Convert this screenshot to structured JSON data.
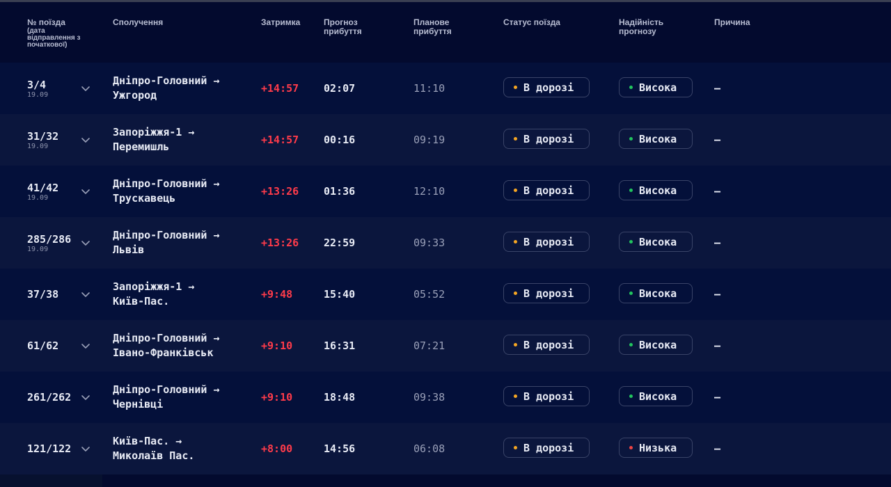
{
  "header": {
    "train_no": "№ поїзда",
    "train_no_sub": "(дата відправлення з початкової)",
    "route": "Сполучення",
    "delay": "Затримка",
    "forecast": "Прогноз прибуття",
    "planned": "Планове прибуття",
    "status": "Статус поїзда",
    "reliability": "Надійність прогнозу",
    "reason": "Причина"
  },
  "colors": {
    "background": "#030a2e",
    "row_dark": "#04103a",
    "row_light": "#0b163d",
    "delay_red": "#ff3b4a",
    "dot_orange": "#f5a623",
    "dot_green": "#22c55e",
    "dot_red": "#ef4444"
  },
  "icons": {
    "expand": "chevron-down-icon",
    "status_dot": "status-dot-icon"
  },
  "rows": [
    {
      "train": "3/4",
      "date": "19.09",
      "from": "Дніпро-Головний →",
      "to": "Ужгород",
      "delay": "+14:57",
      "forecast": "02:07",
      "planned": "11:10",
      "status": "В дорозі",
      "reliability": "Висока",
      "reliability_level": "high",
      "reason": "—"
    },
    {
      "train": "31/32",
      "date": "19.09",
      "from": "Запоріжжя-1 →",
      "to": "Перемишль",
      "delay": "+14:57",
      "forecast": "00:16",
      "planned": "09:19",
      "status": "В дорозі",
      "reliability": "Висока",
      "reliability_level": "high",
      "reason": "—"
    },
    {
      "train": "41/42",
      "date": "19.09",
      "from": "Дніпро-Головний →",
      "to": "Трускавець",
      "delay": "+13:26",
      "forecast": "01:36",
      "planned": "12:10",
      "status": "В дорозі",
      "reliability": "Висока",
      "reliability_level": "high",
      "reason": "—"
    },
    {
      "train": "285/286",
      "date": "19.09",
      "from": "Дніпро-Головний →",
      "to": "Львів",
      "delay": "+13:26",
      "forecast": "22:59",
      "planned": "09:33",
      "status": "В дорозі",
      "reliability": "Висока",
      "reliability_level": "high",
      "reason": "—"
    },
    {
      "train": "37/38",
      "date": "",
      "from": "Запоріжжя-1 →",
      "to": "Київ-Пас.",
      "delay": "+9:48",
      "forecast": "15:40",
      "planned": "05:52",
      "status": "В дорозі",
      "reliability": "Висока",
      "reliability_level": "high",
      "reason": "—"
    },
    {
      "train": "61/62",
      "date": "",
      "from": "Дніпро-Головний →",
      "to": "Івано-Франківськ",
      "delay": "+9:10",
      "forecast": "16:31",
      "planned": "07:21",
      "status": "В дорозі",
      "reliability": "Висока",
      "reliability_level": "high",
      "reason": "—"
    },
    {
      "train": "261/262",
      "date": "",
      "from": "Дніпро-Головний →",
      "to": "Чернівці",
      "delay": "+9:10",
      "forecast": "18:48",
      "planned": "09:38",
      "status": "В дорозі",
      "reliability": "Висока",
      "reliability_level": "high",
      "reason": "—"
    },
    {
      "train": "121/122",
      "date": "",
      "from": "Київ-Пас. →",
      "to": "Миколаїв Пас.",
      "delay": "+8:00",
      "forecast": "14:56",
      "planned": "06:08",
      "status": "В дорозі",
      "reliability": "Низька",
      "reliability_level": "low",
      "reason": "—"
    }
  ]
}
